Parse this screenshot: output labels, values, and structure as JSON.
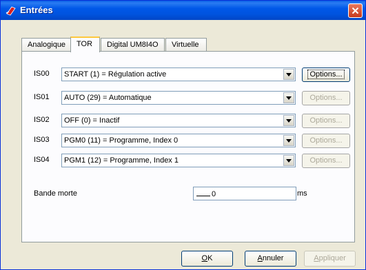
{
  "window": {
    "title": "Entrées",
    "close_icon": "close-icon"
  },
  "tabs": [
    {
      "label": "Analogique",
      "active": false
    },
    {
      "label": "TOR",
      "active": true
    },
    {
      "label": "Digital UM8I4O",
      "active": false
    },
    {
      "label": "Virtuelle",
      "active": false
    }
  ],
  "inputs": [
    {
      "label": "IS00",
      "value": "START (1) = Régulation active",
      "options_label": "Options...",
      "options_enabled": true
    },
    {
      "label": "IS01",
      "value": "AUTO (29) = Automatique",
      "options_label": "Options...",
      "options_enabled": false
    },
    {
      "label": "IS02",
      "value": "OFF (0) = Inactif",
      "options_label": "Options...",
      "options_enabled": false
    },
    {
      "label": "IS03",
      "value": "PGM0 (11) = Programme, Index 0",
      "options_label": "Options...",
      "options_enabled": false
    },
    {
      "label": "IS04",
      "value": "PGM1 (12) = Programme, Index 1",
      "options_label": "Options...",
      "options_enabled": false
    }
  ],
  "dead_band": {
    "label": "Bande morte",
    "value": "0",
    "unit": "ms"
  },
  "buttons": {
    "ok": {
      "prefix": "",
      "mnemonic": "O",
      "rest": "K"
    },
    "cancel": {
      "prefix": "",
      "mnemonic": "A",
      "rest": "nnuler"
    },
    "apply": {
      "prefix": "",
      "mnemonic": "A",
      "rest": "ppliquer"
    }
  },
  "colors": {
    "titlebar": "#0054e3",
    "dialog_bg": "#ece9d8",
    "tab_active_accent": "#ffc83c",
    "close_button": "#c6391d"
  }
}
